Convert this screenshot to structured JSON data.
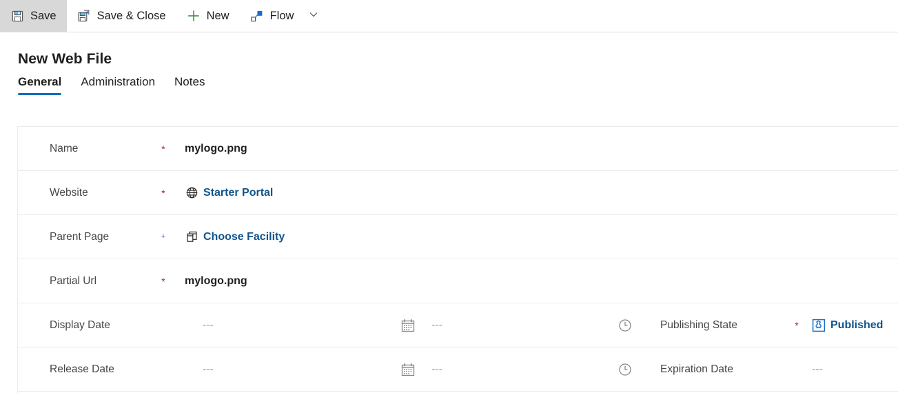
{
  "command_bar": {
    "buttons": [
      {
        "label": "Save",
        "icon": "save-icon",
        "active": true
      },
      {
        "label": "Save & Close",
        "icon": "save-close-icon",
        "active": false
      },
      {
        "label": "New",
        "icon": "plus-icon",
        "active": false
      },
      {
        "label": "Flow",
        "icon": "flow-icon",
        "active": false
      }
    ],
    "overflow_caret_icon": "chevron-down-icon"
  },
  "page": {
    "title": "New Web File"
  },
  "tabs": [
    {
      "label": "General",
      "selected": true
    },
    {
      "label": "Administration",
      "selected": false
    },
    {
      "label": "Notes",
      "selected": false
    }
  ],
  "form": {
    "rows": [
      {
        "label": "Name",
        "required_marker": "*",
        "value": "mylogo.png",
        "value_kind": "text"
      },
      {
        "label": "Website",
        "required_marker": "*",
        "value": "Starter Portal",
        "value_kind": "link",
        "value_icon": "globe-icon"
      },
      {
        "label": "Parent Page",
        "required_marker": "+",
        "value": "Choose Facility",
        "value_kind": "link",
        "value_icon": "pages-icon"
      },
      {
        "label": "Partial Url",
        "required_marker": "*",
        "value": "mylogo.png",
        "value_kind": "text"
      }
    ],
    "date_rows": [
      {
        "label": "Display Date",
        "date_value": "---",
        "calendar_icon": "calendar-icon",
        "time_value": "---",
        "clock_icon": "clock-icon",
        "right_label": "Publishing State",
        "right_required_marker": "*",
        "right_value": "Published",
        "right_value_kind": "link",
        "right_value_icon": "publishing-state-icon"
      },
      {
        "label": "Release Date",
        "date_value": "---",
        "calendar_icon": "calendar-icon",
        "time_value": "---",
        "clock_icon": "clock-icon",
        "right_label": "Expiration Date",
        "right_required_marker": "",
        "right_value": "---",
        "right_value_kind": "dashes",
        "right_value_icon": ""
      }
    ]
  },
  "colors": {
    "accent_blue": "#0f6cbd",
    "link_blue": "#0f548c",
    "required_red": "#a4262c",
    "optional_purple": "#5b5fc7",
    "divider": "#edebe9",
    "active_button_bg": "#d8d8d8",
    "text_primary": "#201f1e",
    "text_secondary": "#484644",
    "muted": "#a19f9d"
  }
}
